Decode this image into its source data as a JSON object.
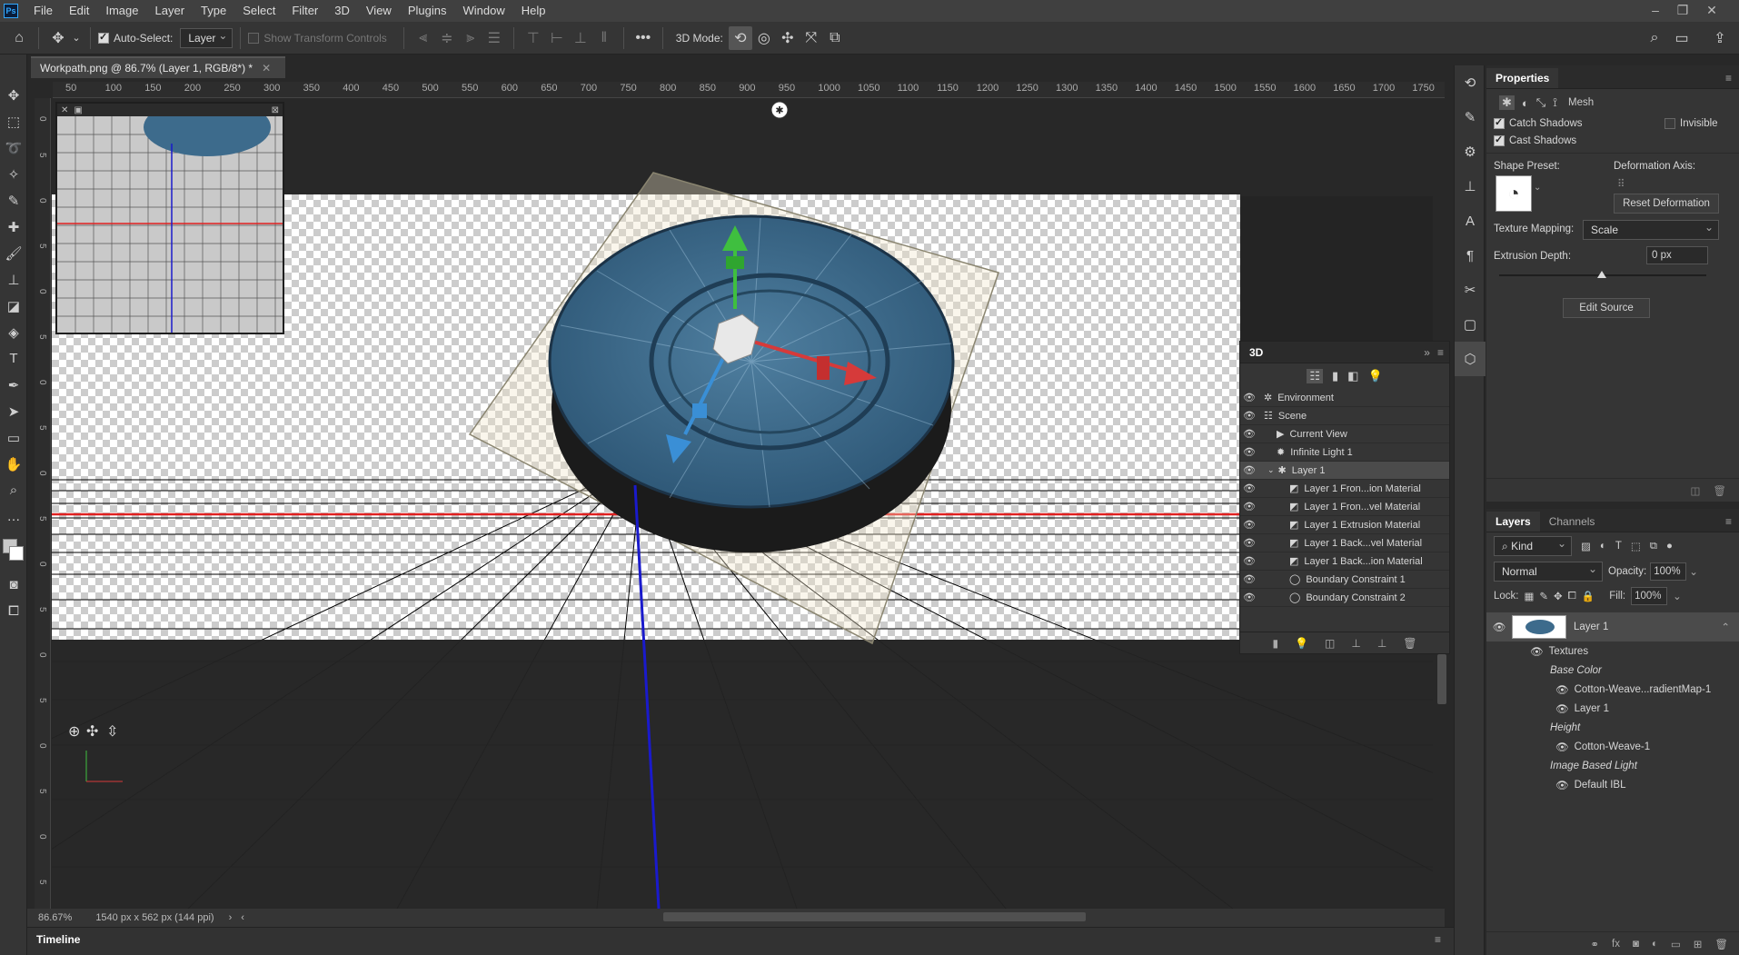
{
  "menubar": {
    "logo": "Ps",
    "items": [
      "File",
      "Edit",
      "Image",
      "Layer",
      "Type",
      "Select",
      "Filter",
      "3D",
      "View",
      "Plugins",
      "Window",
      "Help"
    ]
  },
  "options": {
    "auto_select_label": "Auto-Select:",
    "auto_select_value": "Layer",
    "show_transform_label": "Show Transform Controls",
    "mode_label": "3D Mode:"
  },
  "document": {
    "tab_title": "Workpath.png @ 86.7% (Layer 1, RGB/8*) *",
    "ruler_top": [
      "50",
      "100",
      "150",
      "200",
      "250",
      "300",
      "350",
      "400",
      "450",
      "500",
      "550",
      "600",
      "650",
      "700",
      "750",
      "800",
      "850",
      "900",
      "950",
      "1000",
      "1050",
      "1100",
      "1150",
      "1200",
      "1250",
      "1300",
      "1350",
      "1400",
      "1450",
      "1500",
      "1550",
      "1600",
      "1650",
      "1700",
      "1750"
    ],
    "zoom": "86.67%",
    "doc_info": "1540 px x 562 px (144 ppi)"
  },
  "timeline": {
    "label": "Timeline"
  },
  "properties": {
    "title": "Properties",
    "mesh_label": "Mesh",
    "catch_shadows": "Catch Shadows",
    "cast_shadows": "Cast Shadows",
    "invisible": "Invisible",
    "shape_preset": "Shape Preset:",
    "deformation_axis": "Deformation Axis:",
    "reset_deformation": "Reset Deformation",
    "texture_mapping_label": "Texture Mapping:",
    "texture_mapping_value": "Scale",
    "extrusion_depth_label": "Extrusion Depth:",
    "extrusion_depth_value": "0 px",
    "edit_source": "Edit Source"
  },
  "panel3d": {
    "title": "3D",
    "rows": [
      {
        "label": "Environment"
      },
      {
        "label": "Scene"
      },
      {
        "label": "Current View"
      },
      {
        "label": "Infinite Light 1"
      },
      {
        "label": "Layer 1"
      },
      {
        "label": "Layer 1 Fron...ion Material"
      },
      {
        "label": "Layer 1 Fron...vel Material"
      },
      {
        "label": "Layer 1 Extrusion Material"
      },
      {
        "label": "Layer 1 Back...vel Material"
      },
      {
        "label": "Layer 1 Back...ion Material"
      },
      {
        "label": "Boundary Constraint 1"
      },
      {
        "label": "Boundary Constraint 2"
      }
    ]
  },
  "layers": {
    "tab_layers": "Layers",
    "tab_channels": "Channels",
    "kind": "Kind",
    "blend_mode": "Normal",
    "opacity_label": "Opacity:",
    "opacity_value": "100%",
    "lock_label": "Lock:",
    "fill_label": "Fill:",
    "fill_value": "100%",
    "layer_name": "Layer 1",
    "textures": "Textures",
    "base_color": "Base Color",
    "tex1": "Cotton-Weave...radientMap-1",
    "tex2": "Layer 1",
    "height": "Height",
    "tex3": "Cotton-Weave-1",
    "ibl": "Image Based Light",
    "tex4": "Default IBL"
  },
  "colors": {
    "axis_red": "#e02020",
    "axis_blue": "#1a1acc",
    "gizmo_green": "#3fbf3f",
    "gizmo_red": "#d63a3a",
    "gizmo_blue": "#3a8fd6",
    "disc_blue": "#3d6b8c"
  }
}
